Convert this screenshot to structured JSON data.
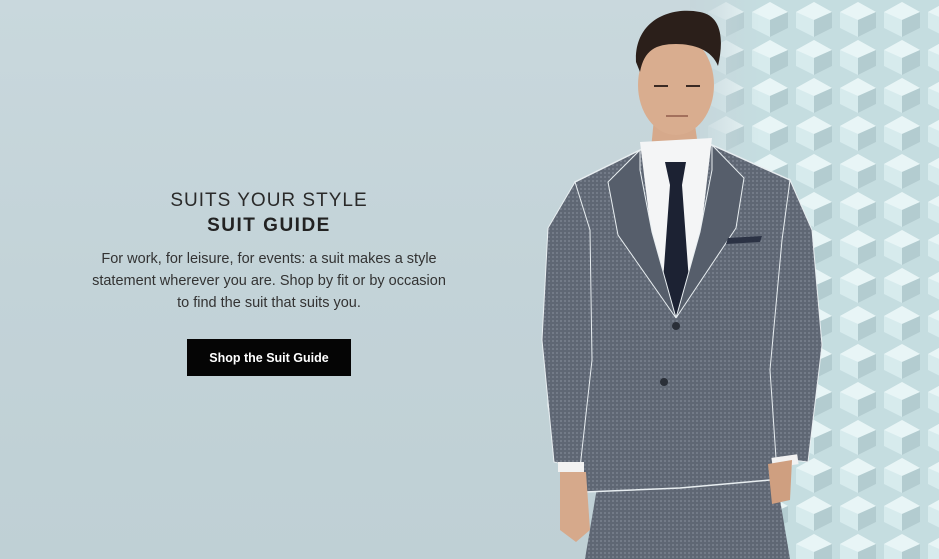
{
  "hero": {
    "eyebrow": "SUITS YOUR STYLE",
    "headline": "SUIT GUIDE",
    "body": "For work, for leisure, for events: a suit makes a style statement wherever you are. Shop by fit or by occasion to find the suit that suits you.",
    "cta_label": "Shop the Suit Guide"
  },
  "colors": {
    "background": "#c6d6db",
    "cta_background": "#050505",
    "cta_text": "#ffffff",
    "suit": "#5d6571",
    "tie": "#1c2233"
  }
}
